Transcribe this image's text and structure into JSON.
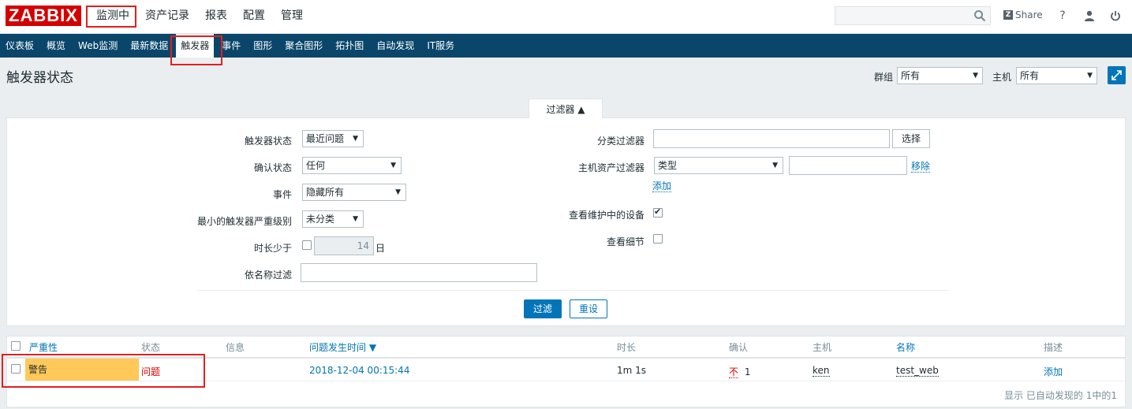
{
  "logo": "ZABBIX",
  "top_menu": [
    "监测中",
    "资产记录",
    "报表",
    "配置",
    "管理"
  ],
  "header": {
    "share": "Share",
    "help": "?"
  },
  "sub_menu": [
    "仪表板",
    "概览",
    "Web监测",
    "最新数据",
    "触发器",
    "事件",
    "图形",
    "聚合图形",
    "拓扑图",
    "自动发现",
    "IT服务"
  ],
  "page": {
    "title": "触发器状态",
    "group_label": "群组",
    "group_value": "所有",
    "host_label": "主机",
    "host_value": "所有"
  },
  "filter": {
    "tab_label": "过滤器 ▲",
    "trigger_status_label": "触发器状态",
    "trigger_status_value": "最近问题",
    "ack_status_label": "确认状态",
    "ack_status_value": "任何",
    "events_label": "事件",
    "events_value": "隐藏所有",
    "min_severity_label": "最小的触发器严重级别",
    "min_severity_value": "未分类",
    "age_label": "时长少于",
    "age_value": "14",
    "age_unit": "日",
    "name_label": "依名称过滤",
    "name_value": "",
    "app_label": "分类过滤器",
    "app_value": "",
    "select_button": "选择",
    "inventory_label": "主机资产过滤器",
    "inventory_field": "类型",
    "inventory_value": "",
    "remove_link": "移除",
    "add_link": "添加",
    "maintenance_label": "查看维护中的设备",
    "maintenance_checked": true,
    "details_label": "查看细节",
    "details_checked": false,
    "apply_button": "过滤",
    "reset_button": "重设"
  },
  "table": {
    "columns": [
      "严重性",
      "状态",
      "信息",
      "问题发生时间 ▼",
      "时长",
      "确认",
      "主机",
      "名称",
      "描述"
    ],
    "rows": [
      {
        "severity": "警告",
        "status": "问题",
        "info": "",
        "time": "2018-12-04 00:15:44",
        "duration": "1m 1s",
        "ack_no": "不",
        "ack_count": "1",
        "host": "ken",
        "name": "test_web",
        "description": "添加"
      }
    ],
    "footer": "显示 已自动发现的 1中的1"
  },
  "colors": {
    "brand": "#d40000",
    "nav": "#0a466a",
    "accent": "#0275b8",
    "warning": "#ffc859",
    "problem": "#dc0000",
    "highlight": "#e02020"
  }
}
